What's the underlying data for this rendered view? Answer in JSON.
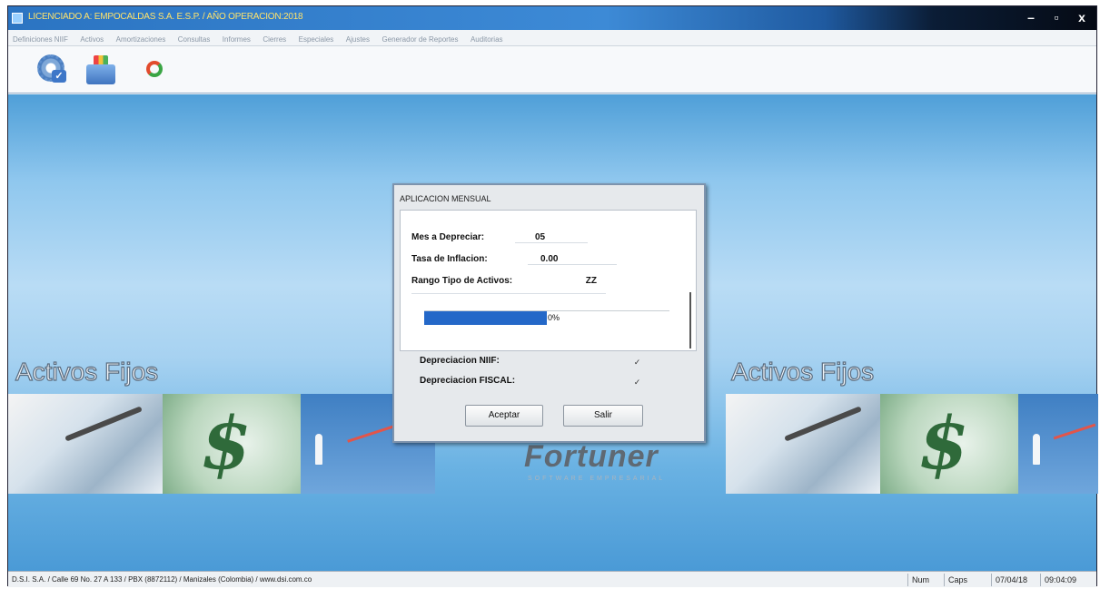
{
  "window": {
    "title": "LICENCIADO A: EMPOCALDAS S.A. E.S.P.  /  AÑO OPERACION:2018",
    "controls": {
      "minimize": "–",
      "restore": "▫",
      "close": "x"
    }
  },
  "menu": {
    "items": [
      "Definiciones NIIF",
      "Activos",
      "Amortizaciones",
      "Consultas",
      "Informes",
      "Cierres",
      "Especiales",
      "Ajustes",
      "Generador de Reportes",
      "Auditorias"
    ]
  },
  "toolbar": {
    "icons": [
      "gear-check-icon",
      "toolbox-icon",
      "refresh-icon"
    ]
  },
  "background": {
    "left_caption": "Activos Fijos",
    "right_caption": "Activos Fijos",
    "brand_name": "Fortuner",
    "brand_tagline": "SOFTWARE EMPRESARIAL",
    "dollar_glyph": "$"
  },
  "dialog": {
    "title": "APLICACION MENSUAL",
    "fields": {
      "mes_label": "Mes a Depreciar:",
      "mes_value": "05",
      "tasa_label": "Tasa de Inflacion:",
      "tasa_value": "0.00",
      "rango_label": "Rango Tipo de Activos:",
      "rango_value": "ZZ"
    },
    "progress": {
      "fraction": 0.5,
      "text": "0%"
    },
    "checks": {
      "niif_label": "Depreciacion NIIF:",
      "niif_mark": "✓",
      "fiscal_label": "Depreciacion FISCAL:",
      "fiscal_mark": "✓"
    },
    "buttons": {
      "accept": "Aceptar",
      "exit": "Salir"
    }
  },
  "status": {
    "left": "D.S.I. S.A. / Calle 69 No. 27 A 133 / PBX (8872112) / Manizales (Colombia) / www.dsi.com.co",
    "num": "Num",
    "caps": "Caps",
    "date": "07/04/18",
    "time": "09:04:09"
  }
}
